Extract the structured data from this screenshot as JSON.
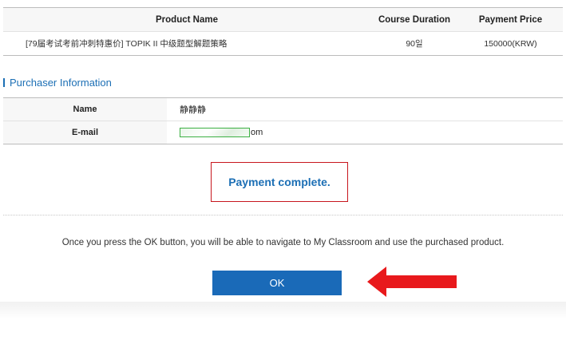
{
  "product_table": {
    "headers": {
      "name": "Product Name",
      "duration": "Course Duration",
      "price": "Payment Price"
    },
    "rows": [
      {
        "name": "[79届考试考前冲刺特惠价] TOPIK II 中级题型解题策略",
        "duration": "90일",
        "price": "150000(KRW)"
      }
    ]
  },
  "purchaser": {
    "section_title": "Purchaser Information",
    "name_label": "Name",
    "name_value": "静静静",
    "email_label": "E-mail",
    "email_visible_suffix": "om"
  },
  "status": {
    "message": "Payment complete."
  },
  "notice": "Once you press the OK button, you will be able to navigate to My Classroom and use the purchased product.",
  "ok_button": {
    "label": "OK"
  },
  "colors": {
    "accent_blue": "#1c6fb5",
    "button_blue": "#1a6ab8",
    "status_border": "#c7161d",
    "arrow_red": "#e8191c",
    "redaction_green": "#3cb043"
  }
}
